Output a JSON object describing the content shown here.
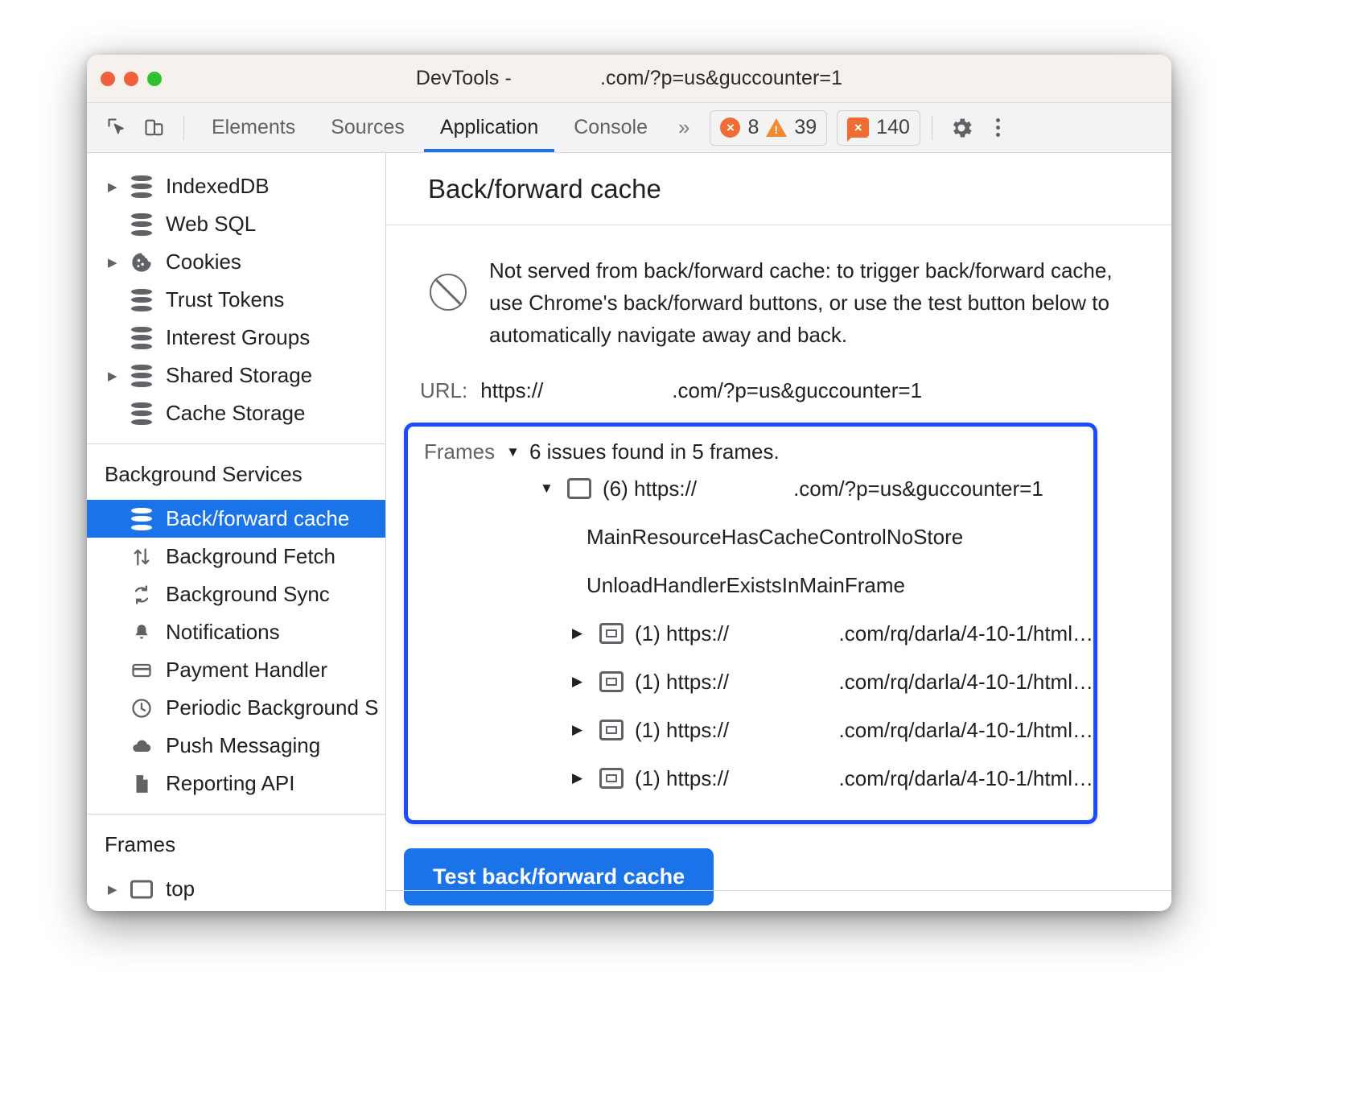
{
  "window": {
    "title_prefix": "DevTools -",
    "title_url_suffix": ".com/?p=us&guccounter=1",
    "traffic_lights": [
      "close-button",
      "minimize-button",
      "zoom-button"
    ]
  },
  "toolbar": {
    "inspect_icon": "inspect-element-icon",
    "device_icon": "device-toolbar-icon",
    "tabs": [
      {
        "label": "Elements",
        "active": false
      },
      {
        "label": "Sources",
        "active": false
      },
      {
        "label": "Application",
        "active": true
      },
      {
        "label": "Console",
        "active": false
      }
    ],
    "more_tabs_label": "»",
    "errors_count": "8",
    "warnings_count": "39",
    "issues_count": "140",
    "settings_icon": "gear-icon",
    "menu_icon": "kebab-menu-icon",
    "accent": "#1a73e8"
  },
  "sidebar": {
    "storage_items": [
      {
        "label": "IndexedDB",
        "icon": "database-icon",
        "expandable": true
      },
      {
        "label": "Web SQL",
        "icon": "database-icon",
        "expandable": false
      },
      {
        "label": "Cookies",
        "icon": "cookie-icon",
        "expandable": true
      },
      {
        "label": "Trust Tokens",
        "icon": "database-icon",
        "expandable": false
      },
      {
        "label": "Interest Groups",
        "icon": "database-icon",
        "expandable": false
      },
      {
        "label": "Shared Storage",
        "icon": "database-icon",
        "expandable": true
      },
      {
        "label": "Cache Storage",
        "icon": "database-icon",
        "expandable": false
      }
    ],
    "background_services_title": "Background Services",
    "background_items": [
      {
        "label": "Back/forward cache",
        "icon": "database-icon",
        "selected": true
      },
      {
        "label": "Background Fetch",
        "icon": "background-fetch-icon",
        "selected": false
      },
      {
        "label": "Background Sync",
        "icon": "sync-icon",
        "selected": false
      },
      {
        "label": "Notifications",
        "icon": "bell-icon",
        "selected": false
      },
      {
        "label": "Payment Handler",
        "icon": "credit-card-icon",
        "selected": false
      },
      {
        "label": "Periodic Background S",
        "icon": "clock-icon",
        "selected": false
      },
      {
        "label": "Push Messaging",
        "icon": "cloud-icon",
        "selected": false
      },
      {
        "label": "Reporting API",
        "icon": "document-icon",
        "selected": false
      }
    ],
    "frames_title": "Frames",
    "frames_items": [
      {
        "label": "top",
        "icon": "frame-icon",
        "expandable": true
      }
    ],
    "selected_bg": "#1a73e8"
  },
  "panel": {
    "title": "Back/forward cache",
    "status_icon": "blocked-icon",
    "status_text": "Not served from back/forward cache: to trigger back/forward cache, use Chrome's back/forward buttons, or use the test button below to automatically navigate away and back.",
    "url_label": "URL:",
    "url_scheme": "https://",
    "url_suffix": ".com/?p=us&guccounter=1",
    "frames_label": "Frames",
    "frames_caret": "▼",
    "frames_summary": "6 issues found in 5 frames.",
    "highlight_color": "#1a4bff",
    "tree": [
      {
        "caret": "▼",
        "icon": "frame-main-icon",
        "count": "(6)",
        "scheme": "https://",
        "url_suffix": ".com/?p=us&guccounter=1",
        "reasons": [
          "MainResourceHasCacheControlNoStore",
          "UnloadHandlerExistsInMainFrame"
        ]
      },
      {
        "caret": "▶",
        "icon": "frame-sub-icon",
        "count": "(1)",
        "scheme": "https://",
        "url_suffix": ".com/rq/darla/4-10-1/html…"
      },
      {
        "caret": "▶",
        "icon": "frame-sub-icon",
        "count": "(1)",
        "scheme": "https://",
        "url_suffix": ".com/rq/darla/4-10-1/html…"
      },
      {
        "caret": "▶",
        "icon": "frame-sub-icon",
        "count": "(1)",
        "scheme": "https://",
        "url_suffix": ".com/rq/darla/4-10-1/html…"
      },
      {
        "caret": "▶",
        "icon": "frame-sub-icon",
        "count": "(1)",
        "scheme": "https://",
        "url_suffix": ".com/rq/darla/4-10-1/html…"
      }
    ],
    "test_button_label": "Test back/forward cache",
    "test_button_color": "#1a73e8"
  }
}
